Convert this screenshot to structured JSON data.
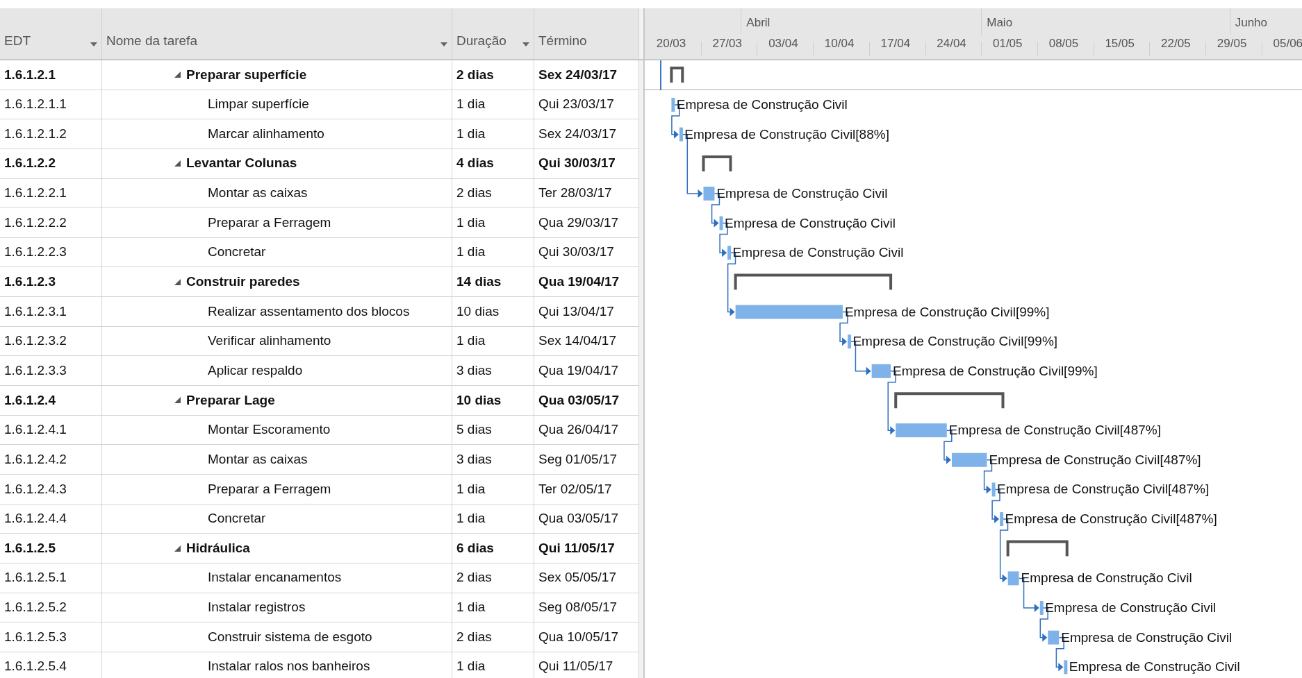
{
  "table": {
    "columns": [
      {
        "label": "EDT",
        "filter": true
      },
      {
        "label": "Nome da tarefa",
        "filter": true
      },
      {
        "label": "Duração",
        "filter": true
      },
      {
        "label": "Término",
        "filter": false
      }
    ],
    "rows": [
      {
        "kind": "summary",
        "expanded": true,
        "edt": "1.6.1.2.1",
        "name": "Preparar superfície",
        "duration": "2 dias",
        "finish": "Sex 24/03/17"
      },
      {
        "kind": "task",
        "edt": "1.6.1.2.1.1",
        "name": "Limpar superfície",
        "duration": "1 dia",
        "finish": "Qui 23/03/17",
        "resource": "Empresa de Construção Civil"
      },
      {
        "kind": "task",
        "edt": "1.6.1.2.1.2",
        "name": "Marcar alinhamento",
        "duration": "1 dia",
        "finish": "Sex 24/03/17",
        "resource": "Empresa de Construção Civil[88%]"
      },
      {
        "kind": "summary",
        "expanded": true,
        "edt": "1.6.1.2.2",
        "name": "Levantar Colunas",
        "duration": "4 dias",
        "finish": "Qui 30/03/17"
      },
      {
        "kind": "task",
        "edt": "1.6.1.2.2.1",
        "name": "Montar as caixas",
        "duration": "2 dias",
        "finish": "Ter 28/03/17",
        "resource": "Empresa de Construção Civil"
      },
      {
        "kind": "task",
        "edt": "1.6.1.2.2.2",
        "name": "Preparar a Ferragem",
        "duration": "1 dia",
        "finish": "Qua 29/03/17",
        "resource": "Empresa de Construção Civil"
      },
      {
        "kind": "task",
        "edt": "1.6.1.2.2.3",
        "name": "Concretar",
        "duration": "1 dia",
        "finish": "Qui 30/03/17",
        "resource": "Empresa de Construção Civil"
      },
      {
        "kind": "summary",
        "expanded": true,
        "edt": "1.6.1.2.3",
        "name": "Construir paredes",
        "duration": "14 dias",
        "finish": "Qua 19/04/17"
      },
      {
        "kind": "task",
        "edt": "1.6.1.2.3.1",
        "name": "Realizar assentamento dos blocos",
        "duration": "10 dias",
        "finish": "Qui 13/04/17",
        "resource": "Empresa de Construção Civil[99%]"
      },
      {
        "kind": "task",
        "edt": "1.6.1.2.3.2",
        "name": "Verificar alinhamento",
        "duration": "1 dia",
        "finish": "Sex 14/04/17",
        "resource": "Empresa de Construção Civil[99%]"
      },
      {
        "kind": "task",
        "edt": "1.6.1.2.3.3",
        "name": "Aplicar respaldo",
        "duration": "3 dias",
        "finish": "Qua 19/04/17",
        "resource": "Empresa de Construção Civil[99%]"
      },
      {
        "kind": "summary",
        "expanded": true,
        "edt": "1.6.1.2.4",
        "name": "Preparar Lage",
        "duration": "10 dias",
        "finish": "Qua 03/05/17"
      },
      {
        "kind": "task",
        "edt": "1.6.1.2.4.1",
        "name": "Montar Escoramento",
        "duration": "5 dias",
        "finish": "Qua 26/04/17",
        "resource": "Empresa de Construção Civil[487%]"
      },
      {
        "kind": "task",
        "edt": "1.6.1.2.4.2",
        "name": "Montar as caixas",
        "duration": "3 dias",
        "finish": "Seg 01/05/17",
        "resource": "Empresa de Construção Civil[487%]"
      },
      {
        "kind": "task",
        "edt": "1.6.1.2.4.3",
        "name": "Preparar a Ferragem",
        "duration": "1 dia",
        "finish": "Ter 02/05/17",
        "resource": "Empresa de Construção Civil[487%]"
      },
      {
        "kind": "task",
        "edt": "1.6.1.2.4.4",
        "name": "Concretar",
        "duration": "1 dia",
        "finish": "Qua 03/05/17",
        "resource": "Empresa de Construção Civil[487%]"
      },
      {
        "kind": "summary",
        "expanded": true,
        "edt": "1.6.1.2.5",
        "name": "Hidráulica",
        "duration": "6 dias",
        "finish": "Qui 11/05/17"
      },
      {
        "kind": "task",
        "edt": "1.6.1.2.5.1",
        "name": "Instalar encanamentos",
        "duration": "2 dias",
        "finish": "Sex 05/05/17",
        "resource": "Empresa de Construção Civil"
      },
      {
        "kind": "task",
        "edt": "1.6.1.2.5.2",
        "name": "Instalar registros",
        "duration": "1 dia",
        "finish": "Seg 08/05/17",
        "resource": "Empresa de Construção Civil"
      },
      {
        "kind": "task",
        "edt": "1.6.1.2.5.3",
        "name": "Construir sistema de esgoto",
        "duration": "2 dias",
        "finish": "Qua 10/05/17",
        "resource": "Empresa de Construção Civil"
      },
      {
        "kind": "task",
        "edt": "1.6.1.2.5.4",
        "name": "Instalar ralos nos banheiros",
        "duration": "1 dia",
        "finish": "Qui 11/05/17",
        "resource": "Empresa de Construção Civil"
      }
    ]
  },
  "timescale": {
    "months": [
      "Abril",
      "Maio",
      "Junho"
    ],
    "weeks": [
      "20/03",
      "27/03",
      "03/04",
      "10/04",
      "17/04",
      "24/04",
      "01/05",
      "08/05",
      "15/05",
      "22/05",
      "29/05",
      "05/06"
    ]
  }
}
